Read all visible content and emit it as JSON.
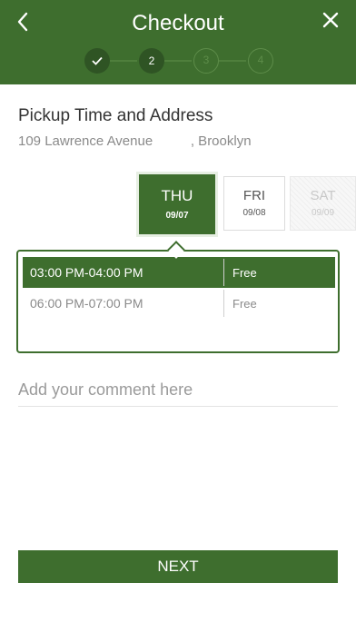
{
  "header": {
    "title": "Checkout",
    "back_icon": "chevron-left-icon",
    "close_icon": "close-icon",
    "color": "#3e6e2e"
  },
  "stepper": {
    "steps": [
      {
        "label": "✓",
        "state": "done"
      },
      {
        "label": "2",
        "state": "current"
      },
      {
        "label": "3",
        "state": "future"
      },
      {
        "label": "4",
        "state": "future"
      }
    ]
  },
  "pickup": {
    "title": "Pickup Time and Address",
    "address": "109 Lawrence Avenue          , Brooklyn"
  },
  "days": [
    {
      "name": "THU",
      "date": "09/07",
      "state": "active"
    },
    {
      "name": "FRI",
      "date": "09/08",
      "state": "available"
    },
    {
      "name": "SAT",
      "date": "09/09",
      "state": "disabled"
    }
  ],
  "slots": [
    {
      "time": "03:00 PM-04:00 PM",
      "price": "Free",
      "selected": true
    },
    {
      "time": "06:00 PM-07:00 PM",
      "price": "Free",
      "selected": false
    }
  ],
  "comment": {
    "placeholder": "Add your comment here",
    "value": ""
  },
  "next_label": "NEXT"
}
